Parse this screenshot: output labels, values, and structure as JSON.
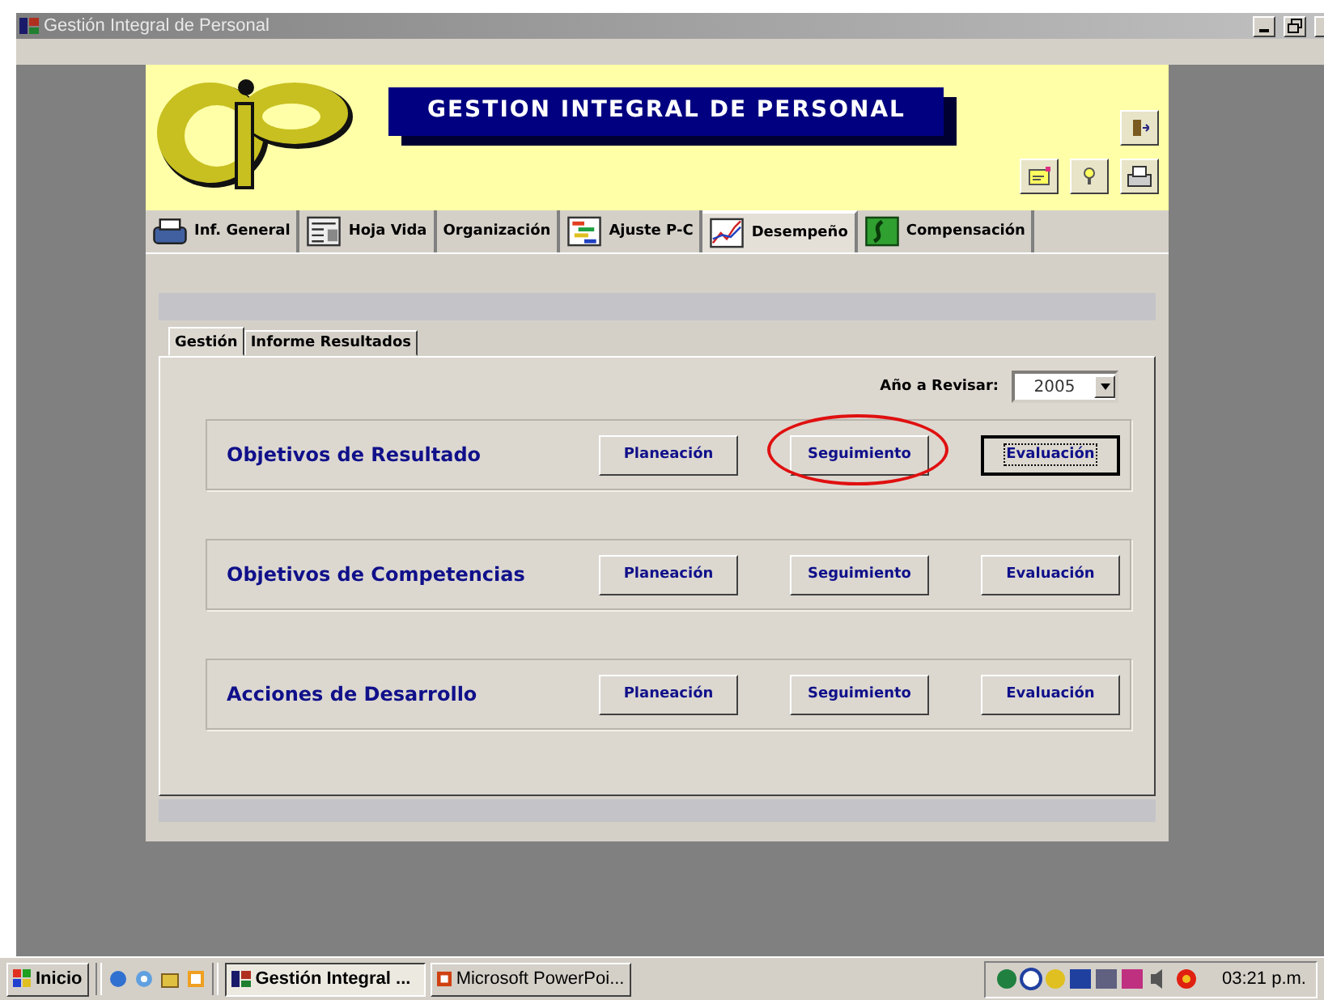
{
  "window": {
    "title": "Gestión Integral de Personal"
  },
  "header": {
    "title": "GESTION INTEGRAL DE PERSONAL"
  },
  "tabs": [
    {
      "label": "Inf. General",
      "kind": "printer",
      "selected": false
    },
    {
      "label": "Hoja Vida",
      "kind": "form",
      "selected": false
    },
    {
      "label": "Organización",
      "kind": "plain",
      "selected": false
    },
    {
      "label": "Ajuste P-C",
      "kind": "gantt",
      "selected": false
    },
    {
      "label": "Desempeño",
      "kind": "chart",
      "selected": true
    },
    {
      "label": "Compensación",
      "kind": "swirl",
      "selected": false
    }
  ],
  "subtabs": [
    {
      "label": "Gestión",
      "selected": true
    },
    {
      "label": "Informe Resultados",
      "selected": false
    }
  ],
  "year": {
    "label": "Año a Revisar:",
    "value": "2005"
  },
  "groups": [
    {
      "title": "Objetivos de Resultado",
      "buttons": [
        {
          "label": "Planeación",
          "focused": false,
          "circled": false
        },
        {
          "label": "Seguimiento",
          "focused": false,
          "circled": true
        },
        {
          "label": "Evaluación",
          "focused": true,
          "circled": false
        }
      ]
    },
    {
      "title": "Objetivos de Competencias",
      "buttons": [
        {
          "label": "Planeación",
          "focused": false,
          "circled": false
        },
        {
          "label": "Seguimiento",
          "focused": false,
          "circled": false
        },
        {
          "label": "Evaluación",
          "focused": false,
          "circled": false
        }
      ]
    },
    {
      "title": "Acciones de Desarrollo",
      "buttons": [
        {
          "label": "Planeación",
          "focused": false,
          "circled": false
        },
        {
          "label": "Seguimiento",
          "focused": false,
          "circled": false
        },
        {
          "label": "Evaluación",
          "focused": false,
          "circled": false
        }
      ]
    }
  ],
  "taskbar": {
    "start": "Inicio",
    "tasks": [
      {
        "label": "Gestión Integral ...",
        "selected": true
      },
      {
        "label": "Microsoft PowerPoi...",
        "selected": false
      }
    ],
    "time": "03:21 p.m."
  }
}
